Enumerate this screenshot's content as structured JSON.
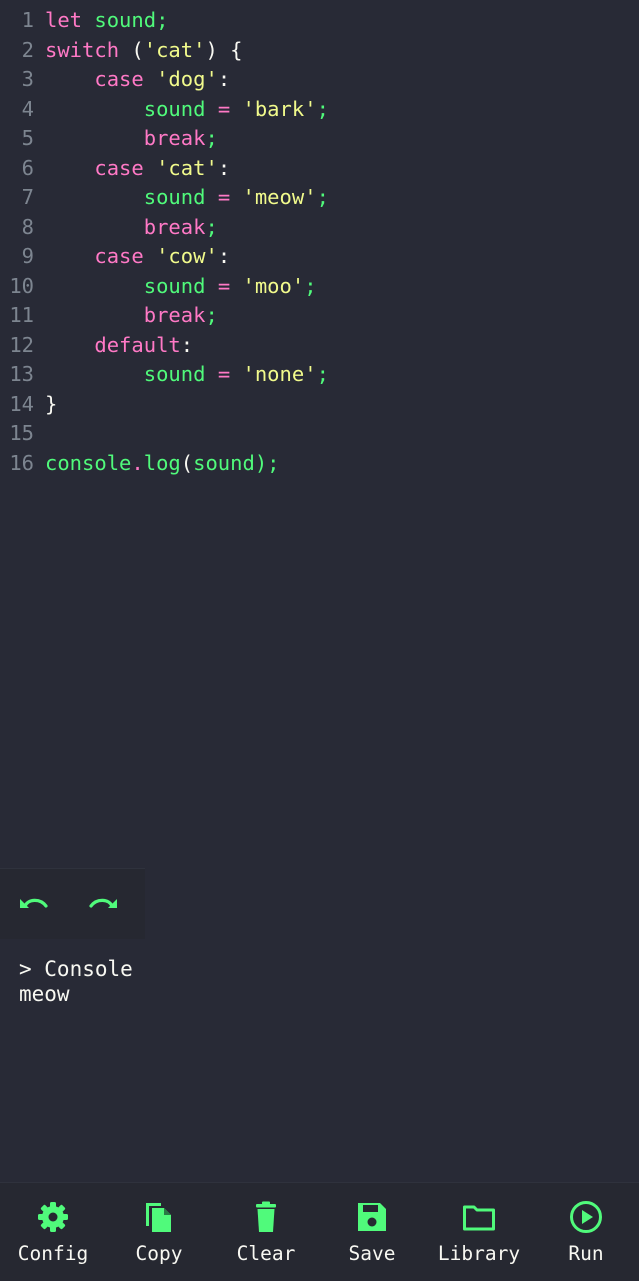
{
  "colors": {
    "background": "#282a36",
    "toolbar_background": "#262831",
    "accent": "#50fa7b",
    "keyword": "#ff79c6",
    "string": "#f1fa8c",
    "text": "#f8f8f2",
    "line_number": "#7d8590"
  },
  "editor": {
    "line_numbers": [
      "1",
      "2",
      "3",
      "4",
      "5",
      "6",
      "7",
      "8",
      "9",
      "10",
      "11",
      "12",
      "13",
      "14",
      "15",
      "16"
    ],
    "lines": [
      [
        {
          "t": "let",
          "c": "t-keyword"
        },
        {
          "t": " ",
          "c": "t-punct"
        },
        {
          "t": "sound",
          "c": "t-ident"
        },
        {
          "t": ";",
          "c": "t-semi"
        }
      ],
      [
        {
          "t": "switch",
          "c": "t-keyword"
        },
        {
          "t": " (",
          "c": "t-punct"
        },
        {
          "t": "'cat'",
          "c": "t-string"
        },
        {
          "t": ") {",
          "c": "t-punct"
        }
      ],
      [
        {
          "t": "    ",
          "c": "t-punct"
        },
        {
          "t": "case",
          "c": "t-keyword"
        },
        {
          "t": " ",
          "c": "t-punct"
        },
        {
          "t": "'dog'",
          "c": "t-string"
        },
        {
          "t": ":",
          "c": "t-punct"
        }
      ],
      [
        {
          "t": "        ",
          "c": "t-punct"
        },
        {
          "t": "sound",
          "c": "t-ident"
        },
        {
          "t": " ",
          "c": "t-punct"
        },
        {
          "t": "=",
          "c": "t-op"
        },
        {
          "t": " ",
          "c": "t-punct"
        },
        {
          "t": "'bark'",
          "c": "t-string"
        },
        {
          "t": ";",
          "c": "t-semi"
        }
      ],
      [
        {
          "t": "        ",
          "c": "t-punct"
        },
        {
          "t": "break",
          "c": "t-keyword"
        },
        {
          "t": ";",
          "c": "t-semi"
        }
      ],
      [
        {
          "t": "    ",
          "c": "t-punct"
        },
        {
          "t": "case",
          "c": "t-keyword"
        },
        {
          "t": " ",
          "c": "t-punct"
        },
        {
          "t": "'cat'",
          "c": "t-string"
        },
        {
          "t": ":",
          "c": "t-punct"
        }
      ],
      [
        {
          "t": "        ",
          "c": "t-punct"
        },
        {
          "t": "sound",
          "c": "t-ident"
        },
        {
          "t": " ",
          "c": "t-punct"
        },
        {
          "t": "=",
          "c": "t-op"
        },
        {
          "t": " ",
          "c": "t-punct"
        },
        {
          "t": "'meow'",
          "c": "t-string"
        },
        {
          "t": ";",
          "c": "t-semi"
        }
      ],
      [
        {
          "t": "        ",
          "c": "t-punct"
        },
        {
          "t": "break",
          "c": "t-keyword"
        },
        {
          "t": ";",
          "c": "t-semi"
        }
      ],
      [
        {
          "t": "    ",
          "c": "t-punct"
        },
        {
          "t": "case",
          "c": "t-keyword"
        },
        {
          "t": " ",
          "c": "t-punct"
        },
        {
          "t": "'cow'",
          "c": "t-string"
        },
        {
          "t": ":",
          "c": "t-punct"
        }
      ],
      [
        {
          "t": "        ",
          "c": "t-punct"
        },
        {
          "t": "sound",
          "c": "t-ident"
        },
        {
          "t": " ",
          "c": "t-punct"
        },
        {
          "t": "=",
          "c": "t-op"
        },
        {
          "t": " ",
          "c": "t-punct"
        },
        {
          "t": "'moo'",
          "c": "t-string"
        },
        {
          "t": ";",
          "c": "t-semi"
        }
      ],
      [
        {
          "t": "        ",
          "c": "t-punct"
        },
        {
          "t": "break",
          "c": "t-keyword"
        },
        {
          "t": ";",
          "c": "t-semi"
        }
      ],
      [
        {
          "t": "    ",
          "c": "t-punct"
        },
        {
          "t": "default",
          "c": "t-keyword"
        },
        {
          "t": ":",
          "c": "t-punct"
        }
      ],
      [
        {
          "t": "        ",
          "c": "t-punct"
        },
        {
          "t": "sound",
          "c": "t-ident"
        },
        {
          "t": " ",
          "c": "t-punct"
        },
        {
          "t": "=",
          "c": "t-op"
        },
        {
          "t": " ",
          "c": "t-punct"
        },
        {
          "t": "'none'",
          "c": "t-string"
        },
        {
          "t": ";",
          "c": "t-semi"
        }
      ],
      [
        {
          "t": "}",
          "c": "t-punct"
        }
      ],
      [],
      [
        {
          "t": "console",
          "c": "t-ident"
        },
        {
          "t": ".",
          "c": "t-op"
        },
        {
          "t": "log",
          "c": "t-ident"
        },
        {
          "t": "(",
          "c": "t-punct"
        },
        {
          "t": "sound",
          "c": "t-ident"
        },
        {
          "t": ");",
          "c": "t-semi"
        }
      ]
    ]
  },
  "history": {
    "undo_icon": "undo-icon",
    "redo_icon": "redo-icon"
  },
  "console": {
    "header": "> Console",
    "output": "meow"
  },
  "toolbar": {
    "items": [
      {
        "label": "Config",
        "icon": "gear-icon"
      },
      {
        "label": "Copy",
        "icon": "copy-icon"
      },
      {
        "label": "Clear",
        "icon": "trash-icon"
      },
      {
        "label": "Save",
        "icon": "floppy-disk-icon"
      },
      {
        "label": "Library",
        "icon": "folder-icon"
      },
      {
        "label": "Run",
        "icon": "play-circle-icon"
      }
    ]
  }
}
